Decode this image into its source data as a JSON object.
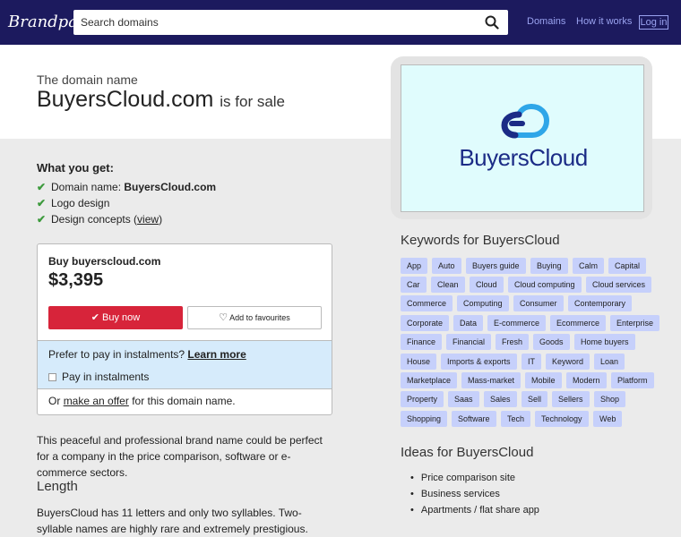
{
  "header": {
    "logo": "Brandpa",
    "search_placeholder": "Search domains",
    "nav": [
      "Domains",
      "How it works"
    ],
    "login": "Log in"
  },
  "hero": {
    "intro": "The domain name",
    "domain": "BuyersCloud.com",
    "for_sale": "is for sale"
  },
  "brand_logo": {
    "text": "BuyersCloud",
    "color": "#1b2b86"
  },
  "what_you_get": {
    "heading": "What you get:",
    "items": [
      {
        "label": "Domain name:",
        "value": "BuyersCloud.com"
      },
      {
        "label": "Logo design"
      },
      {
        "label": "Design concepts (",
        "link": "view",
        "suffix": ")"
      }
    ]
  },
  "buy": {
    "heading": "Buy buyerscloud.com",
    "price": "$3,395",
    "buy_now": "Buy now",
    "add_fav": "Add to favourites",
    "instalments_question": "Prefer to pay in instalments?",
    "learn_more": "Learn more",
    "pay_instalments": "Pay in instalments",
    "offer_prefix": "Or",
    "offer_link": "make an offer",
    "offer_suffix": "for this domain name."
  },
  "description": "This peaceful and professional brand name could be perfect for a company in the price comparison, software or e-commerce sectors.",
  "length": {
    "heading": "Length",
    "text": "BuyersCloud has 11 letters and only two syllables. Two-syllable names are highly rare and extremely prestigious. Examples of popular"
  },
  "keywords": {
    "heading": "Keywords for BuyersCloud",
    "rows": [
      [
        "App",
        "Auto",
        "Buyers guide",
        "Buying",
        "Calm",
        "Capital"
      ],
      [
        "Car",
        "Clean",
        "Cloud",
        "Cloud computing",
        "Cloud services"
      ],
      [
        "Commerce",
        "Computing",
        "Consumer",
        "Contemporary"
      ],
      [
        "Corporate",
        "Data",
        "E-commerce",
        "Ecommerce",
        "Enterprise"
      ],
      [
        "Finance",
        "Financial",
        "Fresh",
        "Goods",
        "Home buyers"
      ],
      [
        "House",
        "Imports & exports",
        "IT",
        "Keyword",
        "Loan"
      ],
      [
        "Marketplace",
        "Mass-market",
        "Mobile",
        "Modern",
        "Platform"
      ],
      [
        "Property",
        "Saas",
        "Sales",
        "Sell",
        "Sellers",
        "Shop"
      ],
      [
        "Shopping",
        "Software",
        "Tech",
        "Technology",
        "Web"
      ]
    ]
  },
  "ideas": {
    "heading": "Ideas for BuyersCloud",
    "items": [
      "Price comparison site",
      "Business services",
      "Apartments / flat share app"
    ]
  },
  "colors": {
    "topbar": "#1c1a5e",
    "buy_button": "#d7243a",
    "keyword_bg": "#c6d0fb",
    "instalments_bg": "#d6ebfb"
  }
}
